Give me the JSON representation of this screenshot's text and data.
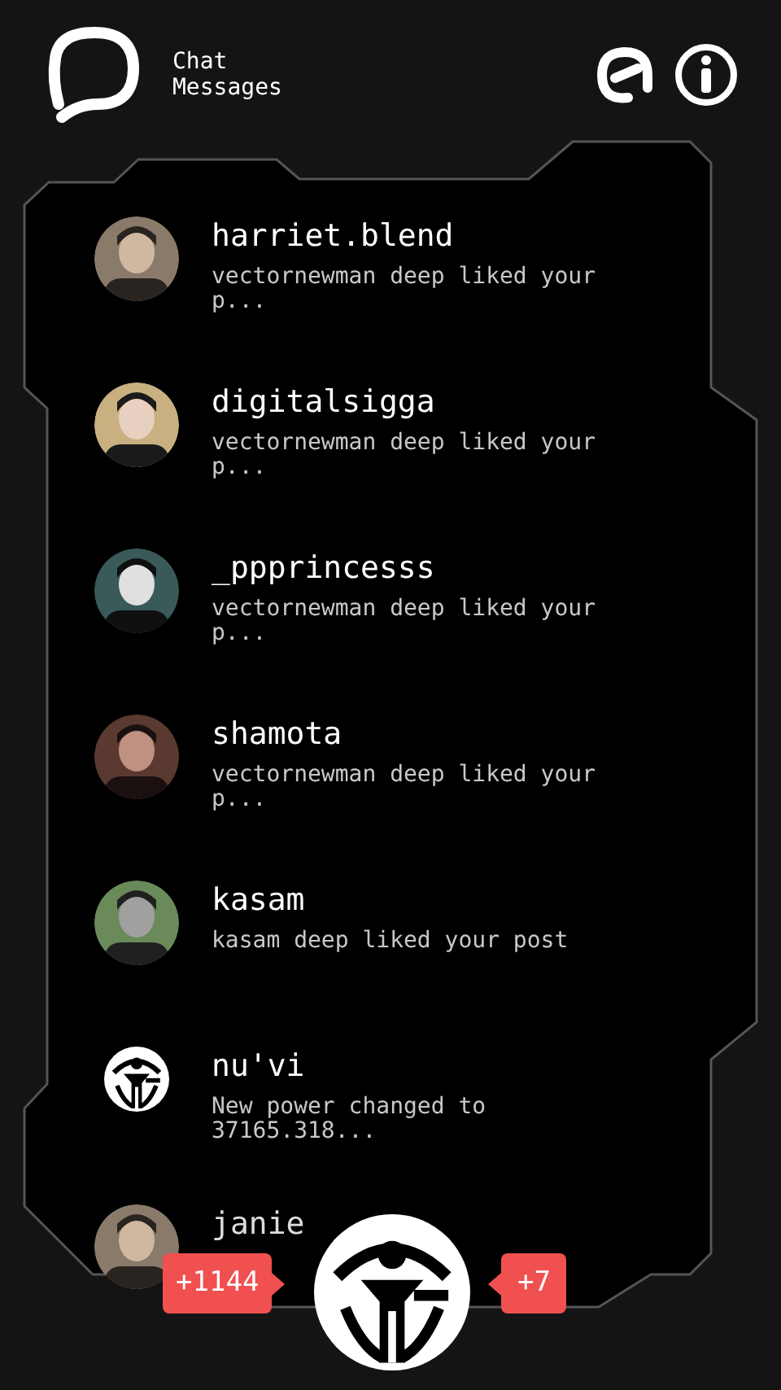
{
  "header": {
    "title_line_1": "Chat",
    "title_line_2": "Messages"
  },
  "messages": [
    {
      "name": "harriet.blend",
      "message": "vectornewman deep liked your p..."
    },
    {
      "name": "digitalsigga",
      "message": "vectornewman deep liked your p..."
    },
    {
      "name": "_ppprincesss",
      "message": "vectornewman deep liked your p..."
    },
    {
      "name": "shamota",
      "message": "vectornewman deep liked your p..."
    },
    {
      "name": "kasam",
      "message": "kasam deep liked your post"
    },
    {
      "kind": "logo",
      "name": "nu'vi",
      "message": "New power changed to 37165.318..."
    }
  ],
  "partial_row": {
    "name": "janie"
  },
  "badges": {
    "left": "+1144",
    "right": "+7"
  }
}
